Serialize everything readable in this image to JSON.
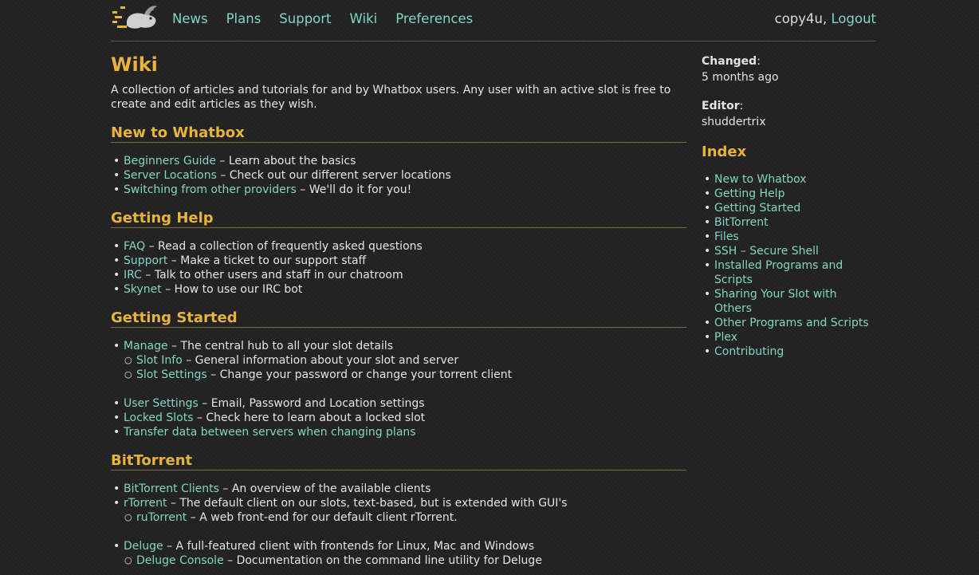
{
  "header": {
    "logo_name": "whatbox-rabbit-logo",
    "nav": [
      "News",
      "Plans",
      "Support",
      "Wiki",
      "Preferences"
    ],
    "username": "copy4u",
    "separator": ", ",
    "logout": "Logout"
  },
  "page": {
    "title": "Wiki",
    "intro": "A collection of articles and tutorials for and by Whatbox users. Any user with an active slot is free to create and edit articles as they wish."
  },
  "sections": [
    {
      "heading": "New to Whatbox",
      "items": [
        {
          "link": "Beginners Guide",
          "desc": " – Learn about the basics"
        },
        {
          "link": "Server Locations",
          "desc": " – Check out our different server locations"
        },
        {
          "link": "Switching from other providers",
          "desc": " – We'll do it for you!"
        }
      ]
    },
    {
      "heading": "Getting Help",
      "items": [
        {
          "link": "FAQ",
          "desc": " – Read a collection of frequently asked questions"
        },
        {
          "link": "Support",
          "desc": " – Make a ticket to our support staff"
        },
        {
          "link": "IRC",
          "desc": " – Talk to other users and staff in our chatroom"
        },
        {
          "link": "Skynet",
          "desc": " – How to use our IRC bot"
        }
      ]
    },
    {
      "heading": "Getting Started",
      "items": [
        {
          "link": "Manage",
          "desc": " – The central hub to all your slot details"
        },
        {
          "link": "Slot Info",
          "desc": " – General information about your slot and server"
        },
        {
          "link": "Slot Settings",
          "desc": " – Change your password or change your torrent client"
        },
        {
          "link": "User Settings",
          "desc": " – Email, Password and Location settings"
        },
        {
          "link": "Locked Slots",
          "desc": " – Check here to learn about a locked slot"
        },
        {
          "link": "Transfer data between servers when changing plans",
          "desc": ""
        }
      ]
    },
    {
      "heading": "BitTorrent",
      "items": [
        {
          "link": "BitTorrent Clients",
          "desc": " – An overview of the available clients"
        },
        {
          "link": "rTorrent",
          "desc": " – The default client on our slots, text-based, but is extended with GUI's"
        },
        {
          "link": "ruTorrent",
          "desc": " – A web front-end for our default client rTorrent."
        },
        {
          "link": "Deluge",
          "desc": " – A full-featured client with frontends for Linux, Mac and Windows"
        },
        {
          "link": "Deluge Console",
          "desc": " – Documentation on the command line utility for Deluge"
        }
      ]
    }
  ],
  "sidebar": {
    "changed_label": "Changed",
    "changed_value": "5 months ago",
    "editor_label": "Editor",
    "editor_value": "shuddertrix",
    "index_title": "Index",
    "index": [
      "New to Whatbox",
      "Getting Help",
      "Getting Started",
      "BitTorrent",
      "Files",
      "SSH – Secure Shell",
      "Installed Programs and Scripts",
      "Sharing Your Slot with Others",
      "Other Programs and Scripts",
      "Plex",
      "Contributing"
    ]
  },
  "colors": {
    "background": "#212121",
    "link": "#7fd6c2",
    "heading": "#e8b339"
  }
}
